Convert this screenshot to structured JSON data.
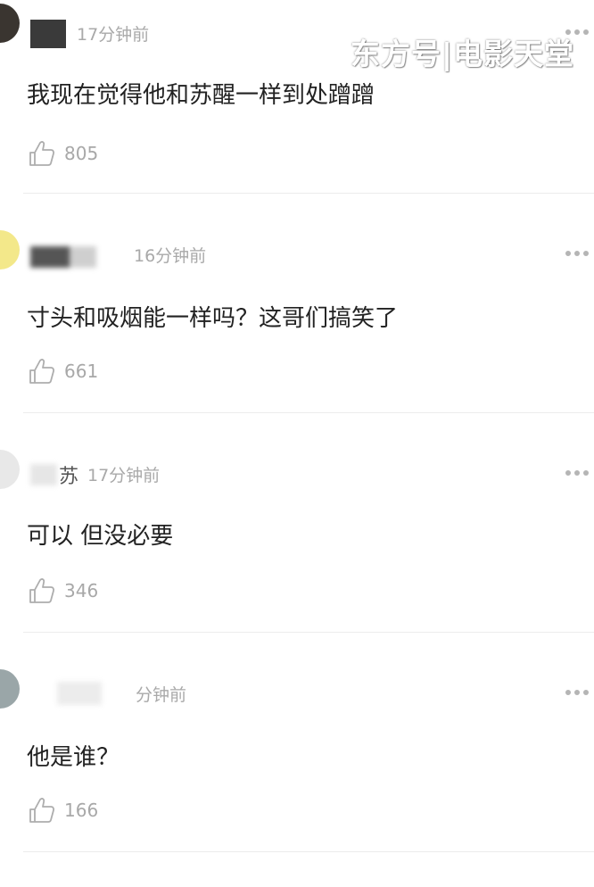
{
  "watermark": "东方号|电影天堂",
  "comments": [
    {
      "time": "17分钟前",
      "text": "我现在觉得他和苏醒一样到处蹭蹭",
      "likes": "805"
    },
    {
      "time": "16分钟前",
      "text": "寸头和吸烟能一样吗？这哥们搞笑了",
      "likes": "661"
    },
    {
      "user_fragment": "苏",
      "time": "17分钟前",
      "text": "可以 但没必要",
      "likes": "346"
    },
    {
      "time": "分钟前",
      "text": "他是谁？",
      "likes": "166"
    }
  ]
}
